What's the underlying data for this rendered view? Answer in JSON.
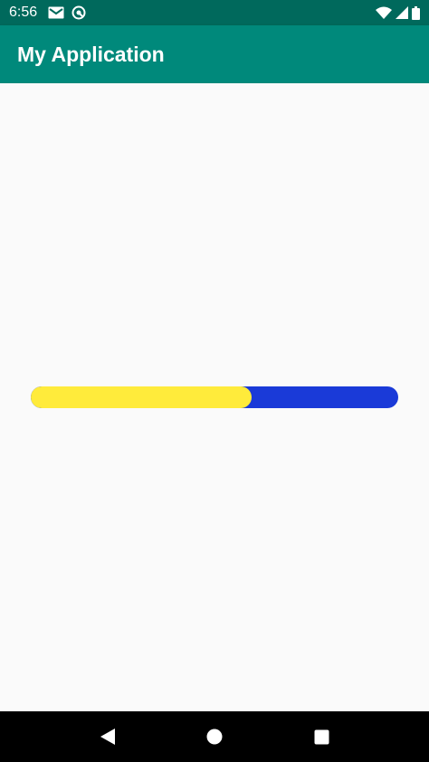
{
  "status_bar": {
    "time": "6:56",
    "left_icons": [
      "gmail-icon",
      "sync-icon"
    ],
    "right_icons": [
      "wifi-icon",
      "cell-signal-icon",
      "battery-icon"
    ]
  },
  "app_bar": {
    "title": "My Application",
    "color": "#00897b"
  },
  "progress": {
    "value_fraction": 0.6,
    "fill_color": "#ffeb3b",
    "track_color": "#1a3ad8"
  },
  "nav_bar": {
    "buttons": [
      "back-icon",
      "home-icon",
      "recents-icon"
    ]
  }
}
